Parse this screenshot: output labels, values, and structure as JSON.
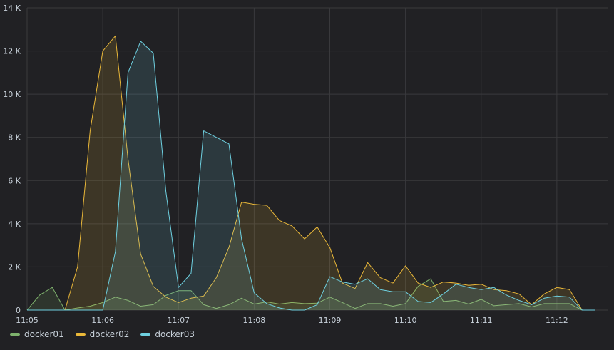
{
  "chart_data": {
    "type": "area",
    "x_ticks": [
      "11:05",
      "11:06",
      "11:07",
      "11:08",
      "11:09",
      "11:10",
      "11:11",
      "11:12"
    ],
    "y_ticks": [
      "0",
      "2 K",
      "4 K",
      "6 K",
      "8 K",
      "10 K",
      "12 K",
      "14 K"
    ],
    "ylim": [
      0,
      14000
    ],
    "xlim_minutes": [
      0,
      7.67
    ],
    "x_step_seconds": 10,
    "grid": true,
    "legend_position": "bottom-left",
    "series": [
      {
        "name": "docker01",
        "color": "#7eb26d",
        "values": [
          0,
          700,
          1050,
          0,
          100,
          180,
          350,
          600,
          450,
          180,
          250,
          680,
          900,
          900,
          250,
          80,
          250,
          550,
          280,
          380,
          280,
          350,
          300,
          320,
          600,
          350,
          80,
          300,
          300,
          180,
          300,
          1100,
          1450,
          400,
          450,
          280,
          500,
          200,
          250,
          300,
          150,
          300,
          300,
          300,
          0,
          0
        ]
      },
      {
        "name": "docker02",
        "color": "#eab839",
        "values": [
          0,
          0,
          0,
          0,
          2000,
          8300,
          12000,
          12700,
          7000,
          2600,
          1100,
          600,
          350,
          550,
          650,
          1500,
          2900,
          5000,
          4900,
          4850,
          4150,
          3900,
          3300,
          3850,
          2900,
          1250,
          1000,
          2200,
          1500,
          1250,
          2050,
          1250,
          1050,
          1300,
          1250,
          1150,
          1200,
          950,
          900,
          750,
          250,
          750,
          1050,
          950,
          0,
          0
        ]
      },
      {
        "name": "docker03",
        "color": "#6ed0e0",
        "values": [
          0,
          0,
          0,
          0,
          0,
          0,
          0,
          2700,
          11000,
          12450,
          11900,
          5500,
          1050,
          1700,
          8300,
          8000,
          7700,
          3300,
          800,
          300,
          100,
          0,
          0,
          250,
          1550,
          1300,
          1200,
          1450,
          950,
          850,
          850,
          400,
          350,
          750,
          1200,
          1050,
          950,
          1050,
          700,
          450,
          250,
          550,
          650,
          600,
          0,
          0
        ]
      }
    ]
  }
}
